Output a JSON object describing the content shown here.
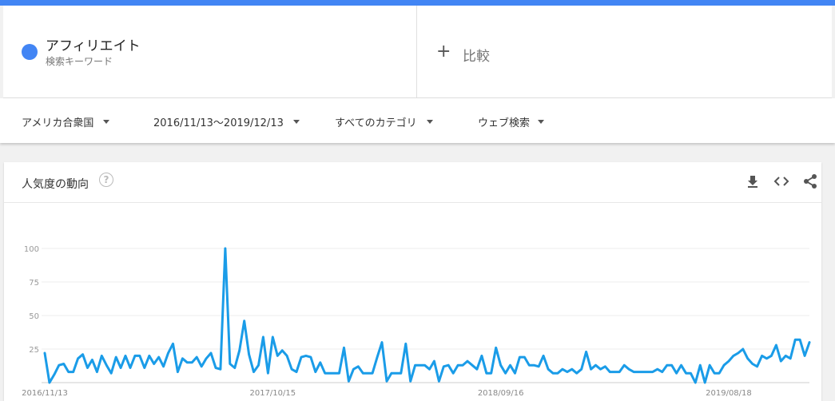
{
  "term": {
    "name": "アフィリエイト",
    "type": "検索キーワード",
    "color": "#4285f4"
  },
  "compare": {
    "icon": "plus-icon",
    "label": "比較"
  },
  "filters": {
    "region": "アメリカ合衆国",
    "date_range": "2016/11/13～2019/12/13",
    "category": "すべてのカテゴリ",
    "search_type": "ウェブ検索"
  },
  "interest_card": {
    "title": "人気度の動向",
    "help_icon": "?",
    "actions": [
      "download-icon",
      "embed-icon",
      "share-icon"
    ]
  },
  "chart_data": {
    "type": "line",
    "title": "",
    "xlabel": "",
    "ylabel": "",
    "ylim": [
      0,
      100
    ],
    "yticks": [
      25,
      50,
      75,
      100
    ],
    "xtick_labels": [
      "2016/11/13",
      "2017/10/15",
      "2018/09/16",
      "2019/08/18"
    ],
    "x_start": "2016/11/13",
    "x_interval": "1 week",
    "grid": true,
    "line_color": "#1a9ce8",
    "series": [
      {
        "values": [
          22,
          0,
          6,
          13,
          14,
          8,
          8,
          18,
          21,
          11,
          17,
          8,
          20,
          13,
          7,
          19,
          11,
          20,
          11,
          20,
          20,
          11,
          20,
          14,
          19,
          12,
          22,
          29,
          8,
          18,
          15,
          15,
          19,
          12,
          18,
          22,
          11,
          10,
          100,
          14,
          11,
          24,
          46,
          21,
          8,
          13,
          34,
          7,
          34,
          20,
          24,
          20,
          10,
          8,
          19,
          20,
          19,
          8,
          15,
          7,
          7,
          7,
          7,
          26,
          1,
          10,
          12,
          7,
          7,
          7,
          19,
          30,
          1,
          7,
          7,
          7,
          29,
          1,
          13,
          13,
          13,
          10,
          16,
          1,
          12,
          13,
          7,
          13,
          13,
          16,
          13,
          10,
          20,
          7,
          7,
          26,
          13,
          7,
          13,
          7,
          19,
          19,
          13,
          13,
          12,
          20,
          10,
          7,
          7,
          10,
          8,
          10,
          7,
          10,
          23,
          10,
          13,
          10,
          12,
          8,
          8,
          8,
          13,
          10,
          8,
          8,
          8,
          8,
          8,
          10,
          8,
          13,
          13,
          7,
          13,
          7,
          7,
          0,
          13,
          0,
          13,
          7,
          7,
          13,
          16,
          20,
          22,
          25,
          18,
          14,
          12,
          20,
          18,
          20,
          28,
          16,
          20,
          18,
          32,
          32,
          20,
          30
        ]
      }
    ]
  }
}
